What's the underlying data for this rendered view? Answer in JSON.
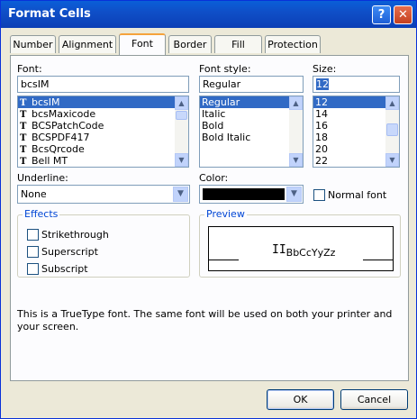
{
  "window": {
    "title": "Format Cells"
  },
  "titlebar_buttons": {
    "help": "?",
    "close": "✕"
  },
  "tabs": [
    {
      "label": "Number"
    },
    {
      "label": "Alignment"
    },
    {
      "label": "Font"
    },
    {
      "label": "Border"
    },
    {
      "label": "Fill"
    },
    {
      "label": "Protection"
    }
  ],
  "font": {
    "label": "Font:",
    "value": "bcsIM",
    "items": [
      {
        "label": "bcsIM",
        "selected": true
      },
      {
        "label": "bcsMaxicode"
      },
      {
        "label": "BCSPatchCode"
      },
      {
        "label": "BCSPDF417"
      },
      {
        "label": "BcsQrcode"
      },
      {
        "label": "Bell MT"
      }
    ]
  },
  "font_style": {
    "label": "Font style:",
    "value": "Regular",
    "items": [
      {
        "label": "Regular",
        "selected": true
      },
      {
        "label": "Italic"
      },
      {
        "label": "Bold"
      },
      {
        "label": "Bold Italic"
      }
    ]
  },
  "size": {
    "label": "Size:",
    "value": "12",
    "items": [
      {
        "label": "12",
        "selected": true
      },
      {
        "label": "14"
      },
      {
        "label": "16"
      },
      {
        "label": "18"
      },
      {
        "label": "20"
      },
      {
        "label": "22"
      }
    ]
  },
  "underline": {
    "label": "Underline:",
    "value": "None"
  },
  "color": {
    "label": "Color:",
    "swatch": "#000000"
  },
  "normal_font": {
    "label": "Normal font",
    "checked": false
  },
  "effects": {
    "title": "Effects",
    "items": [
      {
        "label": "Strikethrough",
        "checked": false
      },
      {
        "label": "Superscript",
        "checked": false
      },
      {
        "label": "Subscript",
        "checked": false
      }
    ]
  },
  "preview": {
    "title": "Preview",
    "sample_bars": "II",
    "sample_text": "BbCcYyZz"
  },
  "info_text": "This is a TrueType font.  The same font will be used on both your printer and your screen.",
  "buttons": {
    "ok": "OK",
    "cancel": "Cancel"
  },
  "colors": {
    "titlebar": "#0b4fc8",
    "selection": "#316ac5",
    "face": "#ece9d8",
    "group_title": "#0046d5"
  }
}
